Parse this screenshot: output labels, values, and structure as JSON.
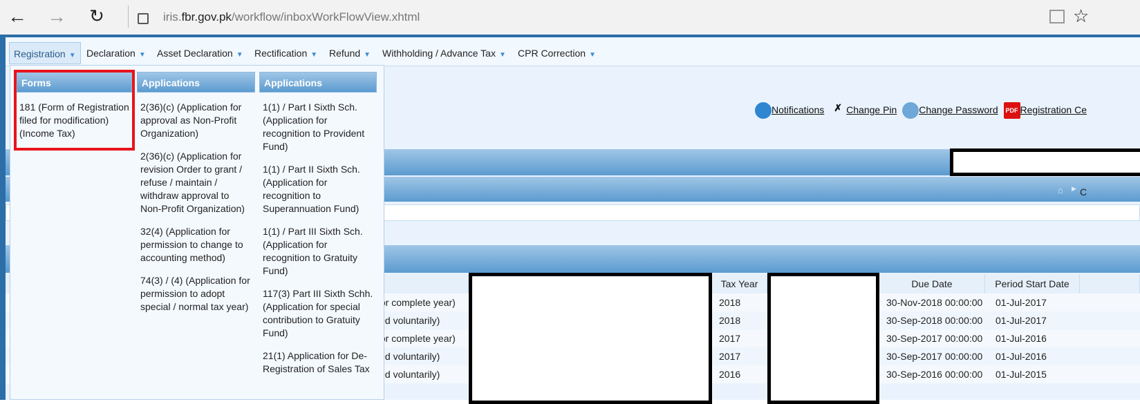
{
  "browser": {
    "back_icon": "arrow-left",
    "forward_icon": "arrow-right",
    "reload_icon": "reload",
    "lock_icon": "lock",
    "url_host_prefix": "iris.",
    "url_host_main": "fbr.gov.pk",
    "url_path": "/workflow/inboxWorkFlowView.xhtml",
    "reading_view_icon": "book",
    "favorite_icon": "star"
  },
  "menu": [
    "Registration",
    "Declaration",
    "Asset Declaration",
    "Rectification",
    "Refund",
    "Withholding / Advance Tax",
    "CPR Correction"
  ],
  "dropdown": {
    "col1": {
      "title": "Forms",
      "items": [
        "181 (Form of Registration filed for modification) (Income Tax)"
      ]
    },
    "col2": {
      "title": "Applications",
      "items": [
        "2(36)(c) (Application for approval as Non-Profit Organization)",
        "2(36)(c) (Application for revision Order to grant / refuse / maintain / withdraw approval to Non-Profit Organization)",
        "32(4) (Application for permission to change to accounting method)",
        "74(3) / (4) (Application for permission to adopt special / normal tax year)"
      ]
    },
    "col3": {
      "title": "Applications",
      "items": [
        "1(1) / Part I Sixth Sch. (Application for recognition to Provident Fund)",
        "1(1) / Part II Sixth Sch. (Application for recognition to Superannuation Fund)",
        "1(1) / Part III Sixth Sch. (Application for recognition to Gratuity Fund)",
        "117(3) Part III Sixth Schh. (Application for special contribution to Gratuity Fund)",
        "21(1) Application for De-Registration of Sales Tax"
      ]
    }
  },
  "links": {
    "notifications": "Notifications",
    "change_pin": "Change Pin",
    "change_password": "Change Password",
    "registration": "Registration Ce",
    "pdf_icon_text": "PDF"
  },
  "breadcrumb_partial": "C",
  "table": {
    "headers": {
      "tax_year": "Tax Year",
      "due_date": "Due Date",
      "period_start": "Period Start Date"
    },
    "rows": [
      {
        "desc": "for complete year)",
        "tax_year": "2018",
        "due": "30-Nov-2018 00:00:00",
        "start": "01-Jul-2017"
      },
      {
        "desc": "led voluntarily)",
        "tax_year": "2018",
        "due": "30-Sep-2018 00:00:00",
        "start": "01-Jul-2017"
      },
      {
        "desc": "for complete year)",
        "tax_year": "2017",
        "due": "30-Sep-2017 00:00:00",
        "start": "01-Jul-2016"
      },
      {
        "desc": "led voluntarily)",
        "tax_year": "2017",
        "due": "30-Sep-2017 00:00:00",
        "start": "01-Jul-2016"
      },
      {
        "desc": "led voluntarily)",
        "tax_year": "2016",
        "due": "30-Sep-2016 00:00:00",
        "start": "01-Jul-2015"
      }
    ]
  }
}
